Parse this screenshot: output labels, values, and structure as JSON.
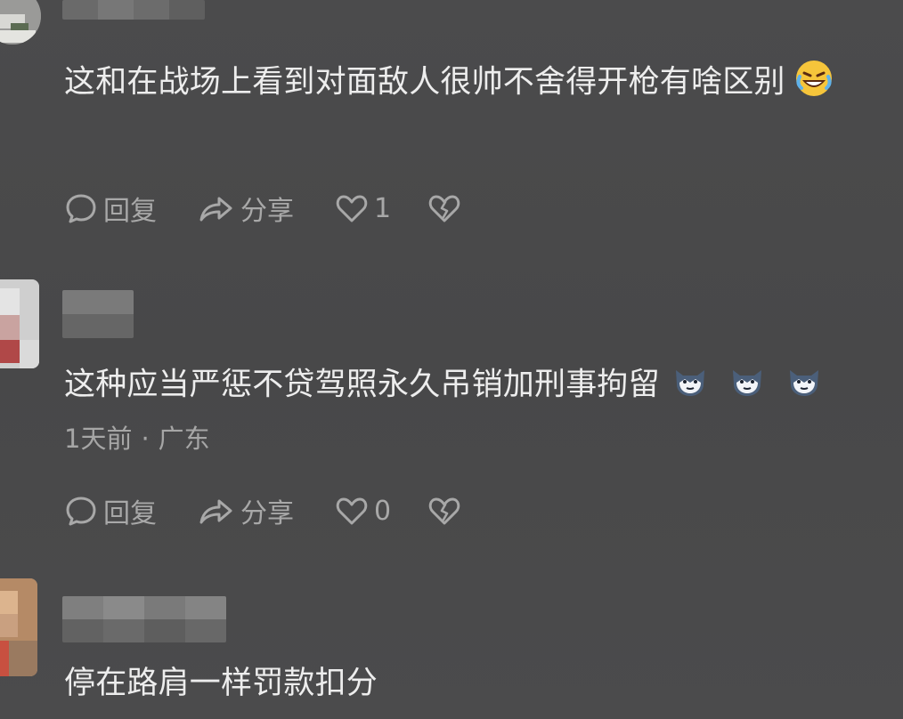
{
  "comments": [
    {
      "text": "这和在战场上看到对面敌人很帅不舍得开枪有啥区别",
      "emoji": "rofl-emoji",
      "meta": null,
      "actions": {
        "reply_label": "回复",
        "share_label": "分享",
        "like_count": "1"
      }
    },
    {
      "text": "这种应当严惩不贷驾照永久吊销加刑事拘留",
      "emoji": "cat-face-emoji",
      "emoji_repeat": 3,
      "meta": {
        "time": "1天前",
        "separator": "·",
        "location": "广东"
      },
      "actions": {
        "reply_label": "回复",
        "share_label": "分享",
        "like_count": "0"
      }
    },
    {
      "text": "停在路肩一样罚款扣分",
      "meta": null
    }
  ],
  "icons": {
    "reply": "speech-bubble-icon",
    "share": "share-arrow-icon",
    "like": "heart-outline-icon",
    "dislike": "broken-heart-icon"
  },
  "colors": {
    "background": "#4a4a4b",
    "text_primary": "#ededed",
    "text_secondary": "#a6a6a6"
  }
}
